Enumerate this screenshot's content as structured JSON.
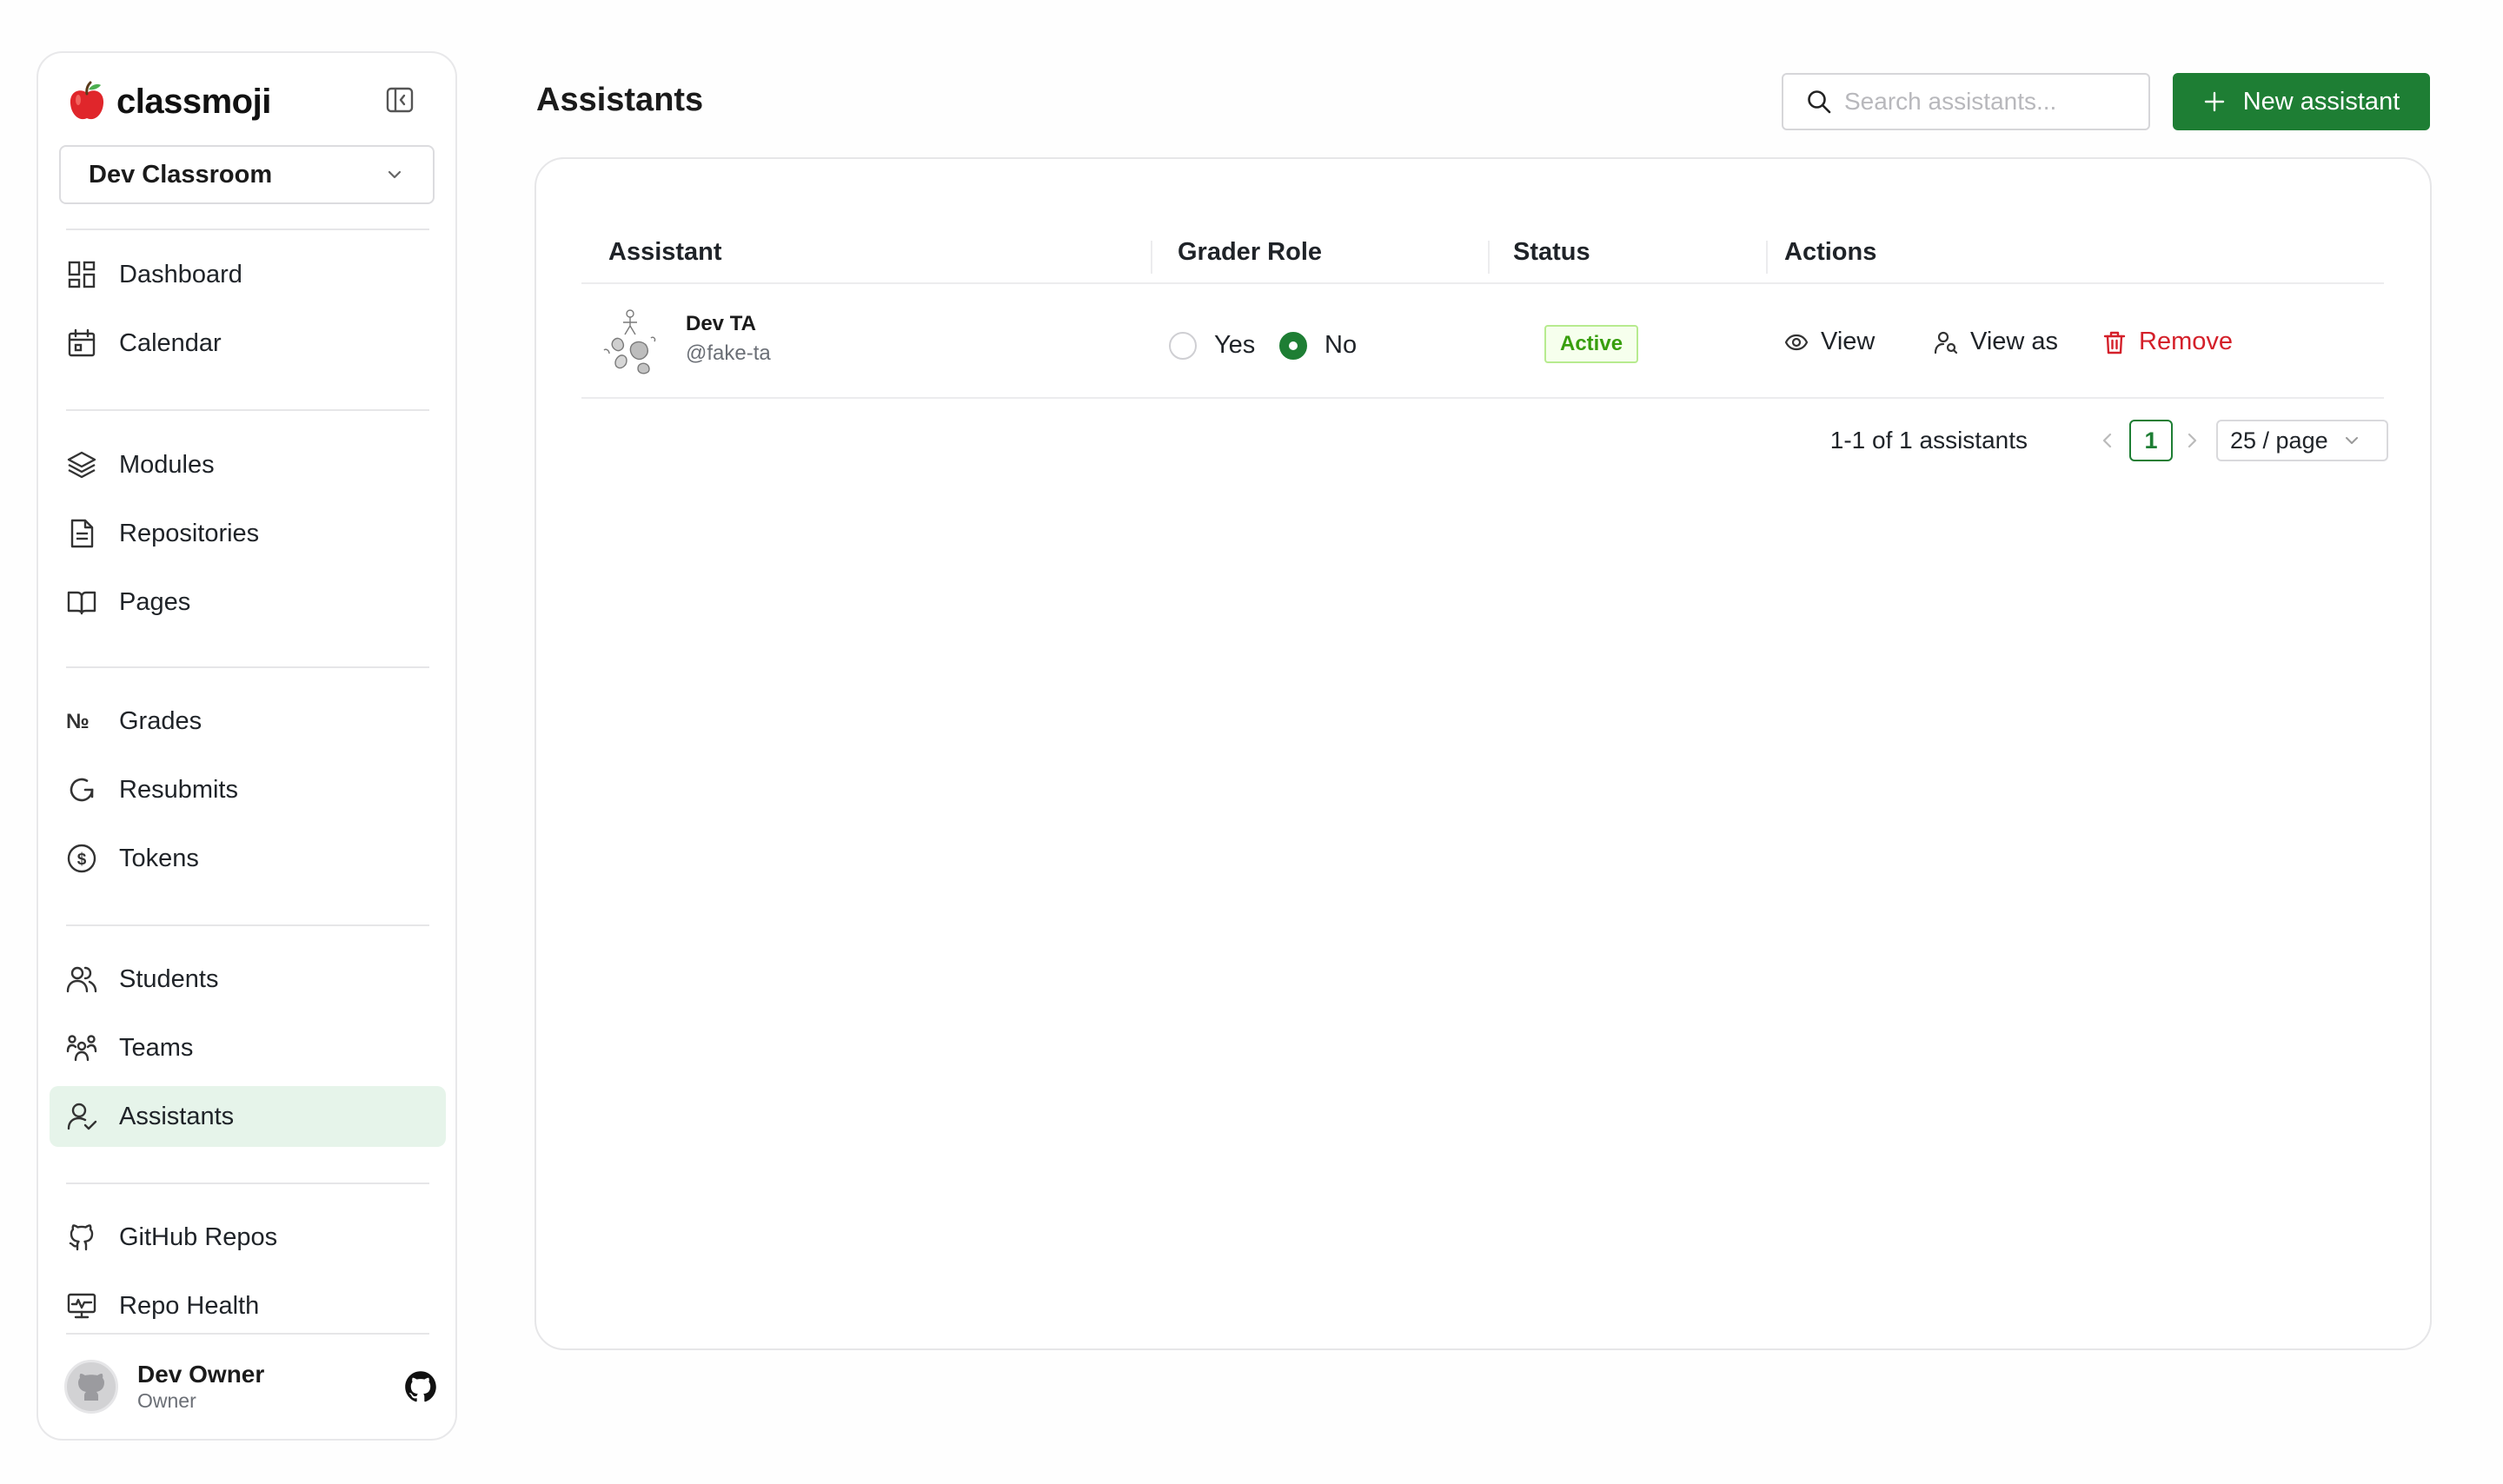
{
  "brand": {
    "name": "classmoji"
  },
  "sidebar": {
    "classroom": "Dev Classroom",
    "groups": [
      [
        {
          "label": "Dashboard",
          "icon": "dashboard-icon"
        },
        {
          "label": "Calendar",
          "icon": "calendar-icon"
        }
      ],
      [
        {
          "label": "Modules",
          "icon": "layers-icon"
        },
        {
          "label": "Repositories",
          "icon": "document-icon"
        },
        {
          "label": "Pages",
          "icon": "book-icon"
        }
      ],
      [
        {
          "label": "Grades",
          "icon": "numero-icon"
        },
        {
          "label": "Resubmits",
          "icon": "refresh-icon"
        },
        {
          "label": "Tokens",
          "icon": "dollar-icon"
        }
      ],
      [
        {
          "label": "Students",
          "icon": "users-icon"
        },
        {
          "label": "Teams",
          "icon": "team-icon"
        },
        {
          "label": "Assistants",
          "icon": "user-check-icon",
          "active": true
        }
      ],
      [
        {
          "label": "GitHub Repos",
          "icon": "github-outline-icon"
        },
        {
          "label": "Repo Health",
          "icon": "monitor-icon"
        }
      ]
    ],
    "user": {
      "name": "Dev Owner",
      "role": "Owner"
    }
  },
  "header": {
    "title": "Assistants",
    "search_placeholder": "Search assistants...",
    "new_button": "New assistant"
  },
  "table": {
    "columns": [
      "Assistant",
      "Grader Role",
      "Status",
      "Actions"
    ],
    "rows": [
      {
        "name": "Dev TA",
        "handle": "@fake-ta",
        "grader_yes": "Yes",
        "grader_no": "No",
        "grader_selected": "No",
        "status": "Active",
        "actions": {
          "view": "View",
          "view_as": "View as",
          "remove": "Remove"
        }
      }
    ]
  },
  "pagination": {
    "total": "1-1 of 1 assistants",
    "current_page": "1",
    "page_size": "25 / page"
  },
  "colors": {
    "accent": "#1e7e34",
    "active_nav_bg": "#e6f4ea",
    "danger": "#d4202a",
    "status_green": "#389e0d"
  }
}
